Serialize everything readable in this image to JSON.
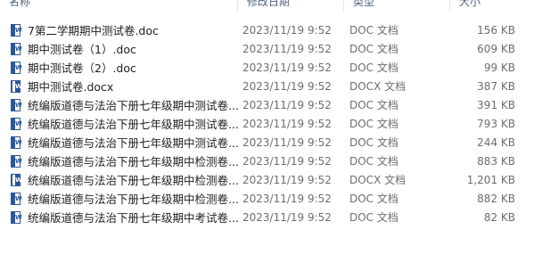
{
  "columns": {
    "name": "名称",
    "date": "修改日期",
    "type": "类型",
    "size": "大小"
  },
  "files": [
    {
      "name": "7第二学期期中测试卷.doc",
      "date": "2023/11/19 9:52",
      "type": "DOC 文档",
      "size": "156 KB",
      "icon": "word-doc-icon"
    },
    {
      "name": "期中测试卷（1）.doc",
      "date": "2023/11/19 9:52",
      "type": "DOC 文档",
      "size": "609 KB",
      "icon": "word-doc-icon"
    },
    {
      "name": "期中测试卷（2）.doc",
      "date": "2023/11/19 9:52",
      "type": "DOC 文档",
      "size": "99 KB",
      "icon": "word-doc-icon"
    },
    {
      "name": "期中测试卷.docx",
      "date": "2023/11/19 9:52",
      "type": "DOCX 文档",
      "size": "387 KB",
      "icon": "word-docx-icon"
    },
    {
      "name": "统编版道德与法治下册七年级期中测试卷...",
      "date": "2023/11/19 9:52",
      "type": "DOC 文档",
      "size": "391 KB",
      "icon": "word-doc-icon"
    },
    {
      "name": "统编版道德与法治下册七年级期中测试卷...",
      "date": "2023/11/19 9:52",
      "type": "DOC 文档",
      "size": "793 KB",
      "icon": "word-doc-icon"
    },
    {
      "name": "统编版道德与法治下册七年级期中测试卷...",
      "date": "2023/11/19 9:52",
      "type": "DOC 文档",
      "size": "244 KB",
      "icon": "word-doc-icon"
    },
    {
      "name": "统编版道德与法治下册七年级期中检测卷...",
      "date": "2023/11/19 9:52",
      "type": "DOC 文档",
      "size": "883 KB",
      "icon": "word-doc-icon"
    },
    {
      "name": "统编版道德与法治下册七年级期中检测卷...",
      "date": "2023/11/19 9:52",
      "type": "DOCX 文档",
      "size": "1,201 KB",
      "icon": "word-docx-icon"
    },
    {
      "name": "统编版道德与法治下册七年级期中检测卷...",
      "date": "2023/11/19 9:52",
      "type": "DOC 文档",
      "size": "882 KB",
      "icon": "word-doc-icon"
    },
    {
      "name": "统编版道德与法治下册七年级期中考试卷...",
      "date": "2023/11/19 9:52",
      "type": "DOC 文档",
      "size": "82 KB",
      "icon": "word-doc-icon"
    }
  ],
  "colors": {
    "header_text": "#4c607a",
    "name_text": "#1e1e1e",
    "detail_text": "#6d6d6d",
    "word_blue": "#2b579a"
  }
}
